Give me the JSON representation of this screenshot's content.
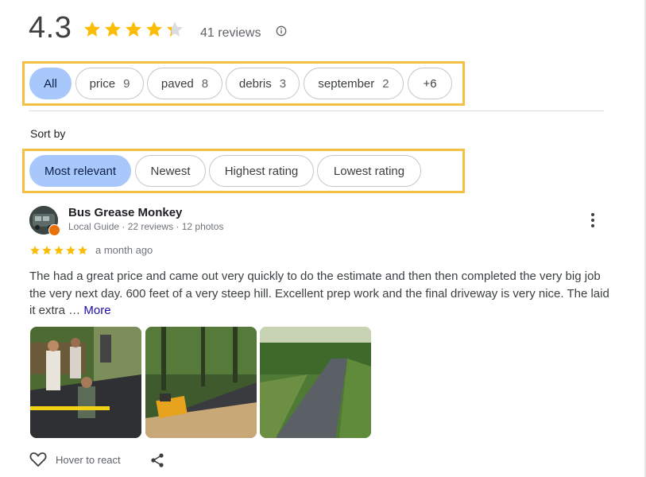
{
  "summary": {
    "rating": "4.3",
    "stars_value": 4.3,
    "reviews_label": "41 reviews",
    "info_icon": "info-icon"
  },
  "topics": [
    {
      "label": "All",
      "count": "",
      "selected": true
    },
    {
      "label": "price",
      "count": "9",
      "selected": false
    },
    {
      "label": "paved",
      "count": "8",
      "selected": false
    },
    {
      "label": "debris",
      "count": "3",
      "selected": false
    },
    {
      "label": "september",
      "count": "2",
      "selected": false
    },
    {
      "label": "+6",
      "count": "",
      "selected": false
    }
  ],
  "sort": {
    "label": "Sort by",
    "options": [
      {
        "label": "Most relevant",
        "selected": true
      },
      {
        "label": "Newest",
        "selected": false
      },
      {
        "label": "Highest rating",
        "selected": false
      },
      {
        "label": "Lowest rating",
        "selected": false
      }
    ]
  },
  "review": {
    "author": "Bus Grease Monkey",
    "meta": "Local Guide · 22 reviews · 12 photos",
    "stars": 5,
    "date": "a month ago",
    "text": "The had a great price and came out very quickly to do the estimate and then then completed the very big job the very next day. 600 feet of a very steep hill. Excellent prep work and the final driveway is very nice. The laid it extra …",
    "more_label": "More",
    "photos": [
      "photo-crew-paving",
      "photo-paving-machine",
      "photo-finished-driveway"
    ],
    "react_label": "Hover to react"
  },
  "colors": {
    "star": "#fbbc04",
    "star_empty": "#dadce0",
    "highlight_box": "#f4c043",
    "selected_chip": "#a8c7fa",
    "link": "#1a0dab",
    "local_guide_badge": "#e8710a"
  }
}
